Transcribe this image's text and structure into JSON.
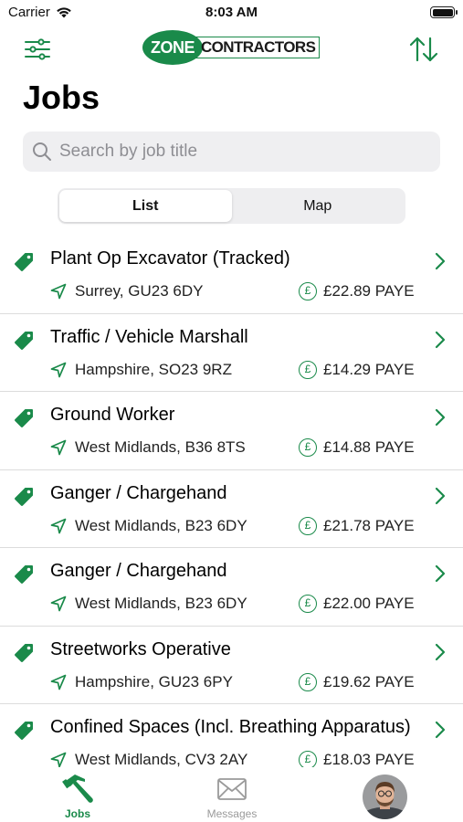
{
  "status_bar": {
    "carrier": "Carrier",
    "time": "8:03 AM"
  },
  "header": {
    "logo_left": "ZONE",
    "logo_right": "CONTRACTORS",
    "brand_color": "#1a8a4a",
    "filter_icon": "sliders-icon",
    "sort_icon": "sort-arrows-icon"
  },
  "page": {
    "title": "Jobs"
  },
  "search": {
    "placeholder": "Search by job title",
    "value": ""
  },
  "view_toggle": {
    "options": [
      "List",
      "Map"
    ],
    "selected": "List"
  },
  "jobs": [
    {
      "title": "Plant Op Excavator (Tracked)",
      "location": "Surrey, GU23 6DY",
      "pay": "£22.89 PAYE"
    },
    {
      "title": "Traffic / Vehicle Marshall",
      "location": "Hampshire, SO23 9RZ",
      "pay": "£14.29 PAYE"
    },
    {
      "title": "Ground Worker",
      "location": "West Midlands, B36 8TS",
      "pay": "£14.88 PAYE"
    },
    {
      "title": "Ganger / Chargehand",
      "location": "West Midlands, B23 6DY",
      "pay": "£21.78 PAYE"
    },
    {
      "title": "Ganger / Chargehand",
      "location": "West Midlands, B23 6DY",
      "pay": "£22.00 PAYE"
    },
    {
      "title": "Streetworks Operative",
      "location": "Hampshire, GU23 6PY",
      "pay": "£19.62 PAYE"
    },
    {
      "title": "Confined Spaces (Incl. Breathing Apparatus)",
      "location": "West Midlands, CV3 2AY",
      "pay": "£18.03 PAYE"
    }
  ],
  "tab_bar": {
    "tabs": [
      {
        "label": "Jobs",
        "icon": "hammer-icon",
        "active": true
      },
      {
        "label": "Messages",
        "icon": "envelope-icon",
        "active": false
      }
    ],
    "profile_icon": "avatar"
  }
}
